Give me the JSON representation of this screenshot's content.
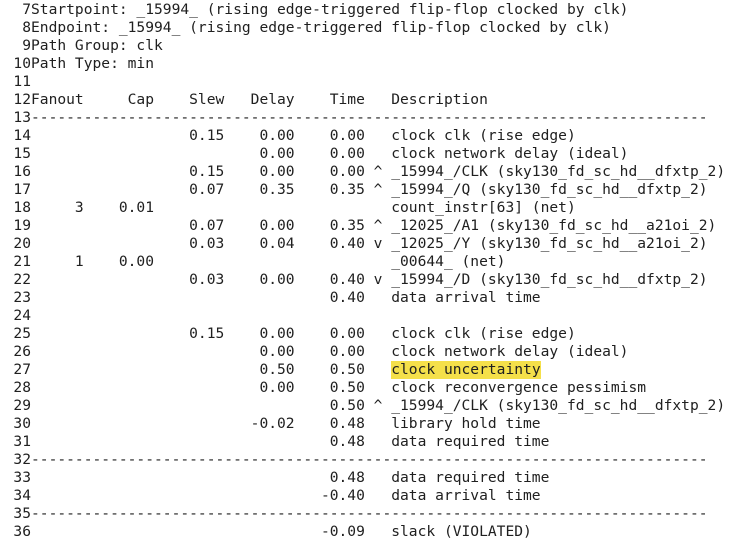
{
  "editor": {
    "lines": [
      {
        "num": "7",
        "text": "Startpoint: _15994_ (rising edge-triggered flip-flop clocked by clk)"
      },
      {
        "num": "8",
        "text": "Endpoint: _15994_ (rising edge-triggered flip-flop clocked by clk)"
      },
      {
        "num": "9",
        "text": "Path Group: clk"
      },
      {
        "num": "10",
        "text": "Path Type: min"
      },
      {
        "num": "11",
        "text": ""
      },
      {
        "num": "12",
        "text": "Fanout     Cap    Slew   Delay    Time   Description"
      },
      {
        "num": "13",
        "text": "-----------------------------------------------------------------------------"
      },
      {
        "num": "14",
        "text": "                  0.15    0.00    0.00   clock clk (rise edge)"
      },
      {
        "num": "15",
        "text": "                          0.00    0.00   clock network delay (ideal)"
      },
      {
        "num": "16",
        "text": "                  0.15    0.00    0.00 ^ _15994_/CLK (sky130_fd_sc_hd__dfxtp_2)"
      },
      {
        "num": "17",
        "text": "                  0.07    0.35    0.35 ^ _15994_/Q (sky130_fd_sc_hd__dfxtp_2)"
      },
      {
        "num": "18",
        "text": "     3    0.01                           count_instr[63] (net)"
      },
      {
        "num": "19",
        "text": "                  0.07    0.00    0.35 ^ _12025_/A1 (sky130_fd_sc_hd__a21oi_2)"
      },
      {
        "num": "20",
        "text": "                  0.03    0.04    0.40 v _12025_/Y (sky130_fd_sc_hd__a21oi_2)"
      },
      {
        "num": "21",
        "text": "     1    0.00                           _00644_ (net)"
      },
      {
        "num": "22",
        "text": "                  0.03    0.00    0.40 v _15994_/D (sky130_fd_sc_hd__dfxtp_2)"
      },
      {
        "num": "23",
        "text": "                                  0.40   data arrival time"
      },
      {
        "num": "24",
        "text": ""
      },
      {
        "num": "25",
        "text": "                  0.15    0.00    0.00   clock clk (rise edge)"
      },
      {
        "num": "26",
        "text": "                          0.00    0.00   clock network delay (ideal)"
      },
      {
        "num": "27",
        "text": "                          0.50    0.50   ",
        "highlight": "clock uncertainty"
      },
      {
        "num": "28",
        "text": "                          0.00    0.50   clock reconvergence pessimism"
      },
      {
        "num": "29",
        "text": "                                  0.50 ^ _15994_/CLK (sky130_fd_sc_hd__dfxtp_2)"
      },
      {
        "num": "30",
        "text": "                         -0.02    0.48   library hold time"
      },
      {
        "num": "31",
        "text": "                                  0.48   data required time"
      },
      {
        "num": "32",
        "text": "-----------------------------------------------------------------------------"
      },
      {
        "num": "33",
        "text": "                                  0.48   data required time"
      },
      {
        "num": "34",
        "text": "                                 -0.40   data arrival time"
      },
      {
        "num": "35",
        "text": "-----------------------------------------------------------------------------"
      },
      {
        "num": "36",
        "text": "                                 -0.09   slack (VIOLATED)"
      }
    ]
  }
}
